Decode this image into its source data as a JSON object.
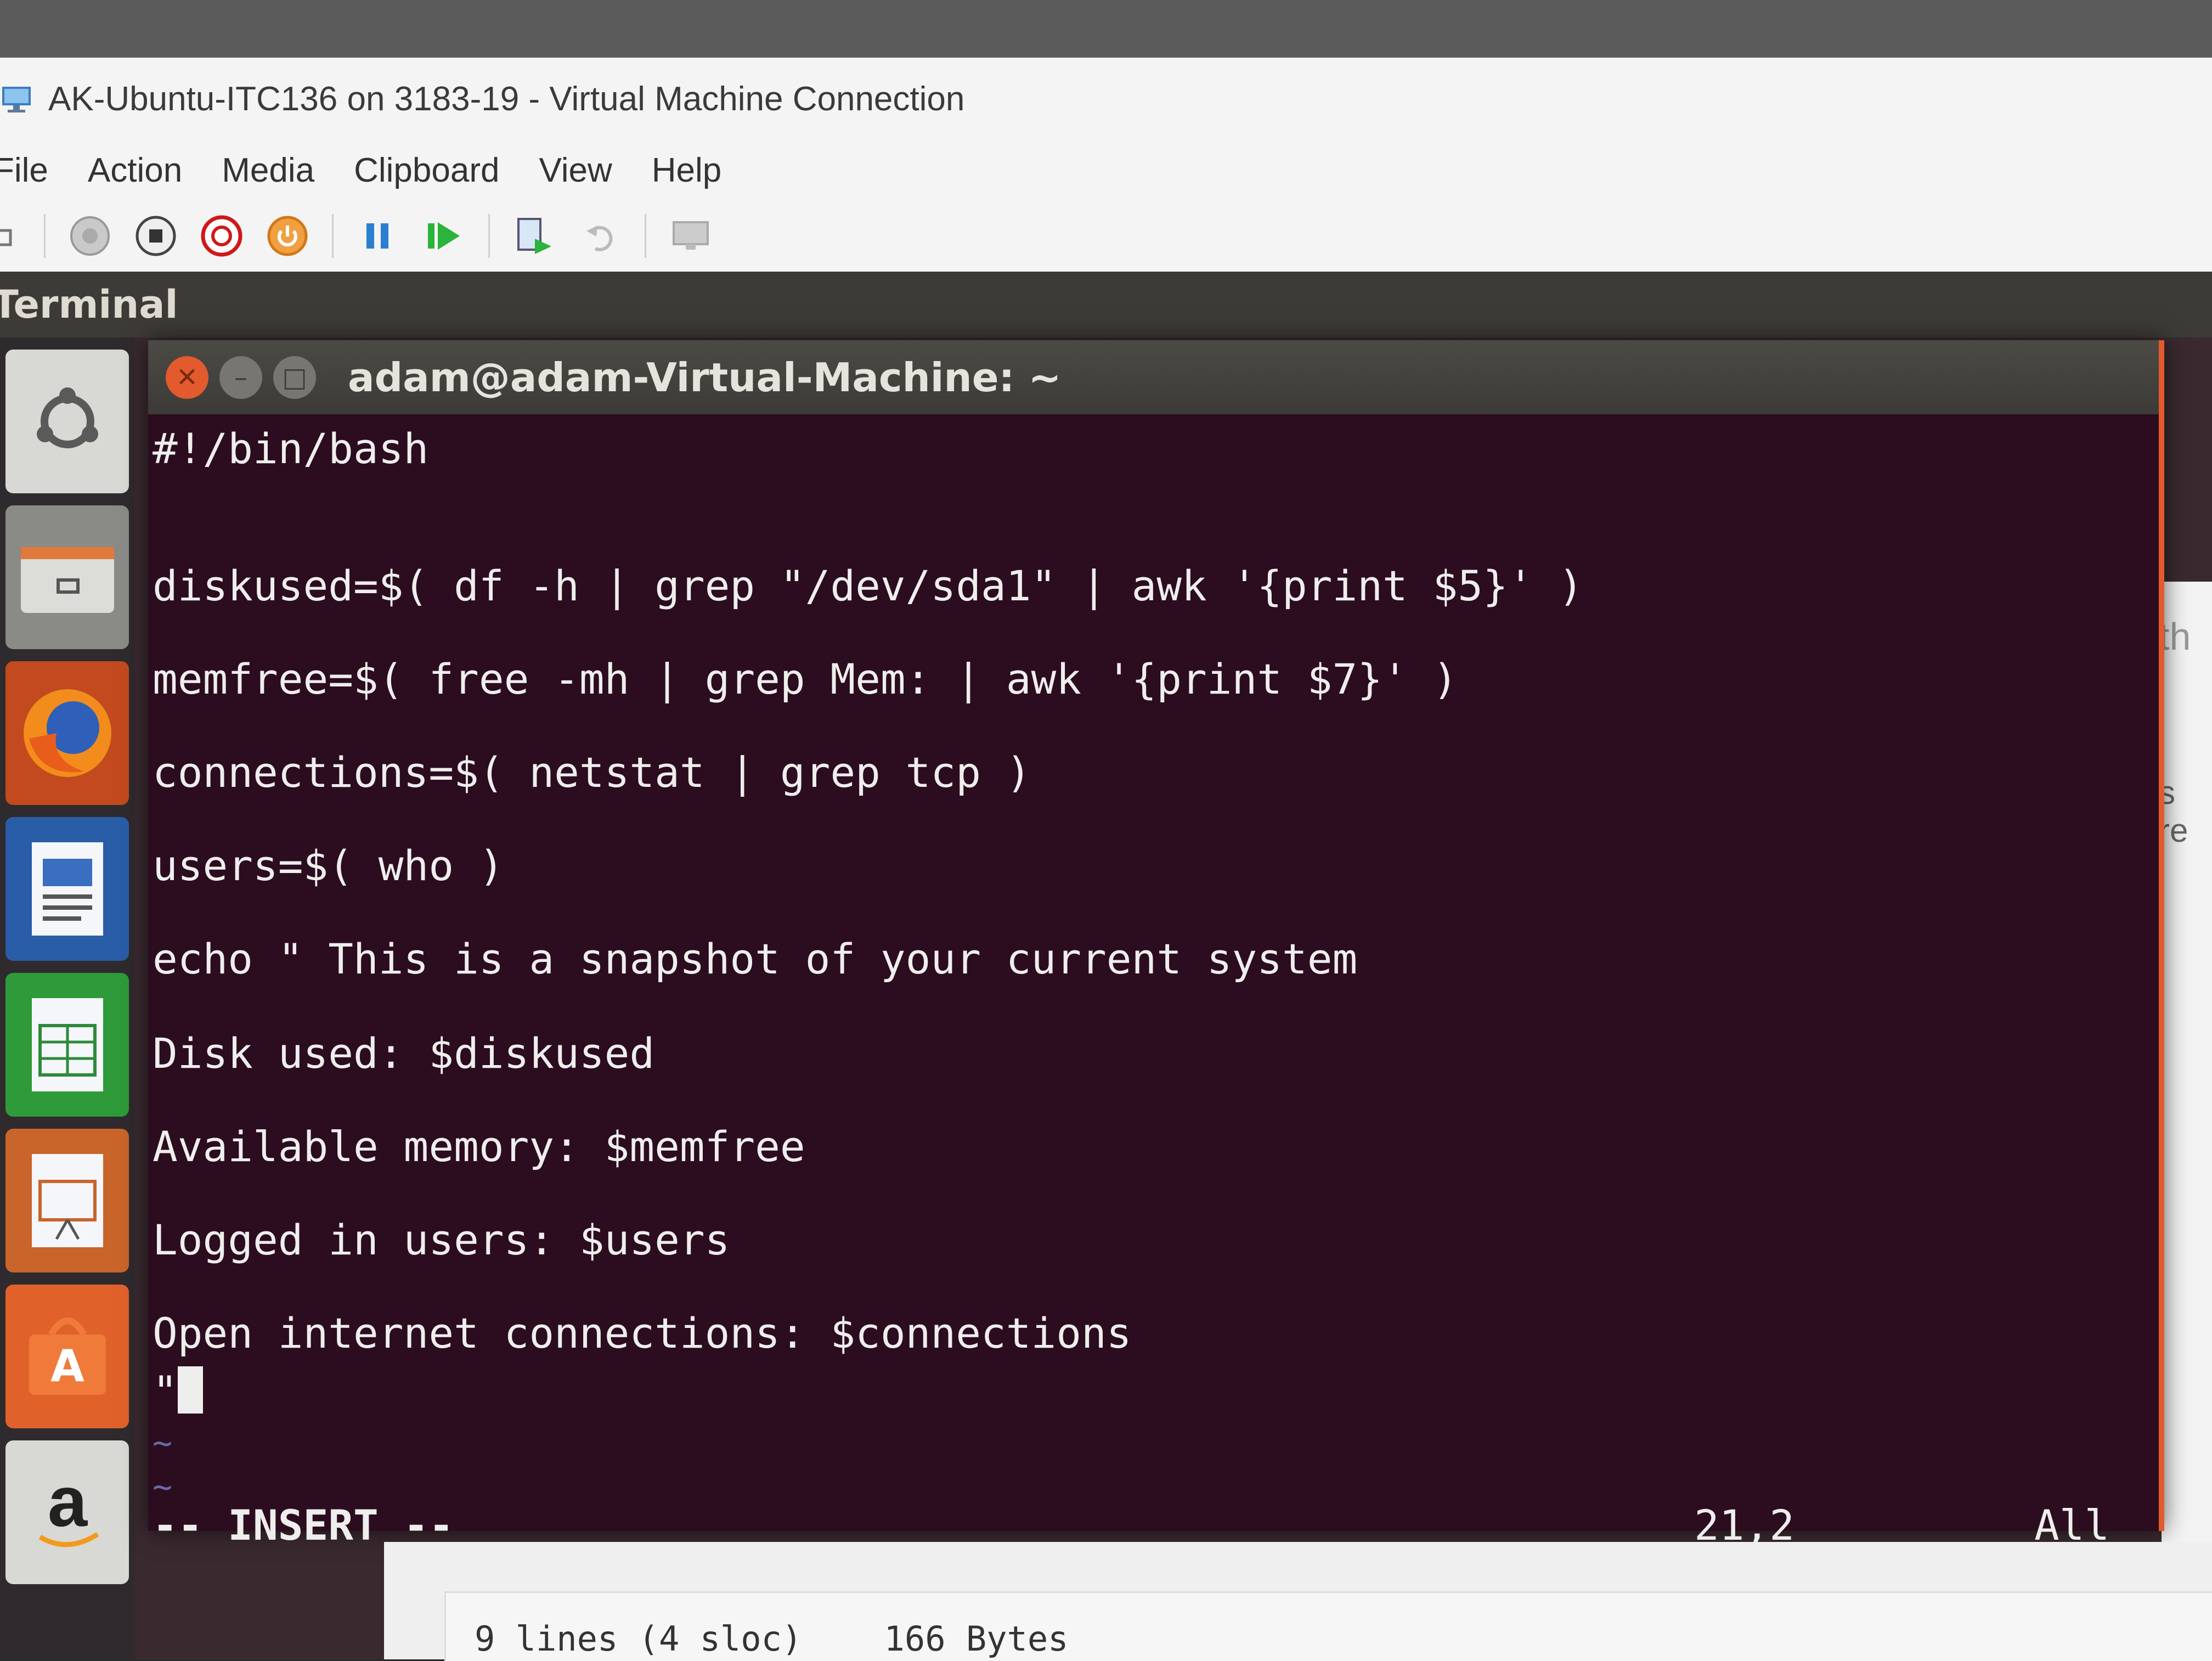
{
  "vm_window": {
    "title": "AK-Ubuntu-ITC136 on 3183-19 - Virtual Machine Connection",
    "menu": [
      "File",
      "Action",
      "Media",
      "Clipboard",
      "View",
      "Help"
    ],
    "toolbar_icons": [
      "ctrl-alt-del-icon",
      "start-icon",
      "turn-off-icon",
      "shutdown-icon",
      "save-state-icon",
      "pause-icon",
      "reset-icon",
      "checkpoint-icon",
      "revert-icon",
      "enhanced-session-icon"
    ]
  },
  "ubuntu_panel": {
    "title": "Terminal"
  },
  "launcher": {
    "items": [
      "ubuntu-dash-icon",
      "files-icon",
      "firefox-icon",
      "writer-icon",
      "calc-icon",
      "impress-icon",
      "software-center-icon",
      "amazon-icon"
    ]
  },
  "terminal": {
    "title": "adam@adam-Virtual-Machine: ~",
    "lines": [
      "#!/bin/bash",
      "diskused=$( df -h | grep \"/dev/sda1\" | awk '{print $5}' )",
      "memfree=$( free -mh | grep Mem: | awk '{print $7}' )",
      "connections=$( netstat | grep tcp )",
      "users=$( who )",
      "echo \" This is a snapshot of your current system",
      "Disk used: $diskused",
      "Available memory: $memfree",
      "Logged in users: $users",
      "Open internet connections: $connections",
      "\""
    ],
    "tildes": [
      "~",
      "~"
    ],
    "status": {
      "mode": "-- INSERT --",
      "position": "21,2",
      "scroll": "All"
    }
  },
  "background_page": {
    "file_info": "9 lines (4 sloc)    166 Bytes",
    "fragment_1": "th",
    "fragment_2": "s re"
  }
}
